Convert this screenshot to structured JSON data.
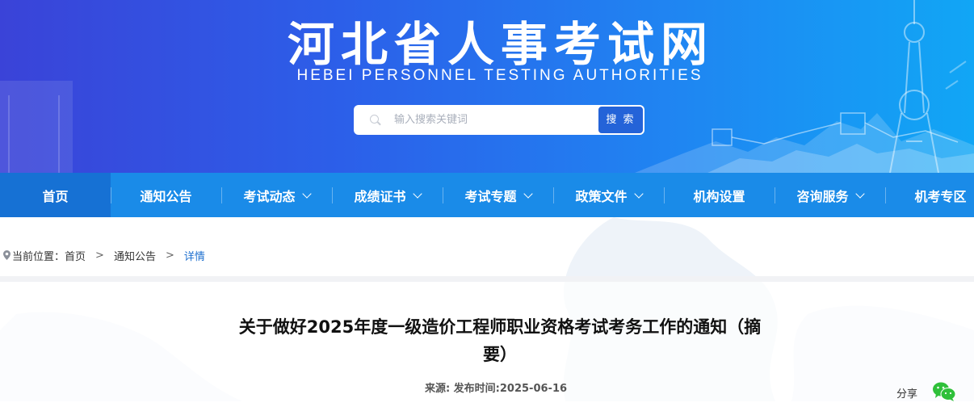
{
  "header": {
    "title": "河北省人事考试网",
    "subtitle": "HEBEI  PERSONNEL  TESTING  AUTHORITIES",
    "search": {
      "placeholder": "输入搜索关键词",
      "value": "",
      "button_label": "搜 索"
    }
  },
  "nav": {
    "items": [
      {
        "label": "首页",
        "has_dropdown": false,
        "active": true
      },
      {
        "label": "通知公告",
        "has_dropdown": false
      },
      {
        "label": "考试动态",
        "has_dropdown": true
      },
      {
        "label": "成绩证书",
        "has_dropdown": true
      },
      {
        "label": "考试专题",
        "has_dropdown": true
      },
      {
        "label": "政策文件",
        "has_dropdown": true
      },
      {
        "label": "机构设置",
        "has_dropdown": false
      },
      {
        "label": "咨询服务",
        "has_dropdown": true
      },
      {
        "label": "机考专区",
        "has_dropdown": false
      }
    ]
  },
  "breadcrumb": {
    "prefix": "当前位置：",
    "items": [
      "首页",
      "通知公告"
    ],
    "current": "详情",
    "separator": ">"
  },
  "article": {
    "title": "关于做好2025年度一级造价工程师职业资格考试考务工作的通知（摘要）",
    "meta": "来源:  发布时间:2025-06-16"
  },
  "share": {
    "label": "分享",
    "icon": "wechat-icon"
  },
  "colors": {
    "banner_start": "#3a43d8",
    "banner_end": "#11a6f5",
    "nav_bg": "#1a8be8",
    "nav_active": "#1671d4",
    "breadcrumb_current": "#1d6fcf",
    "wechat_green": "#2fc03a"
  }
}
